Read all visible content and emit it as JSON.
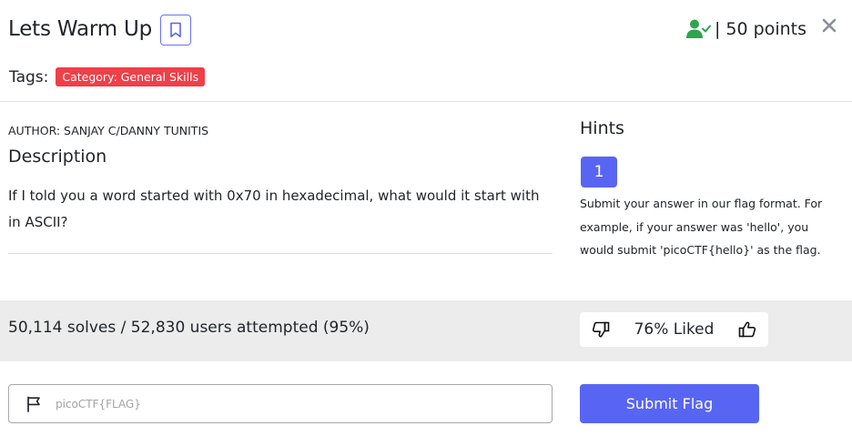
{
  "challenge": {
    "title": "Lets Warm Up",
    "points": "| 50 points",
    "tags_label": "Tags:",
    "tags": [
      "Category: General Skills"
    ],
    "author": "AUTHOR: SANJAY C/DANNY TUNITIS",
    "description_heading": "Description",
    "description": "If I told you a word started with 0x70 in hexadecimal, what would it start with in ASCII?"
  },
  "hints": {
    "heading": "Hints",
    "items": [
      {
        "label": "1",
        "text": "Submit your answer in our flag format. For example, if your answer was 'hello', you would submit 'picoCTF{hello}' as the flag."
      }
    ]
  },
  "stats": {
    "solves": "50,114 solves / 52,830 users attempted (95%)",
    "liked": "76% Liked"
  },
  "flag": {
    "placeholder": "picoCTF{FLAG}",
    "value": "",
    "submit_label": "Submit Flag"
  },
  "icons": {
    "bookmark": "bookmark-icon",
    "solved": "user-check-icon",
    "close": "close-icon",
    "thumbs_down": "thumbs-down-icon",
    "thumbs_up": "thumbs-up-icon",
    "flag": "flag-icon"
  },
  "colors": {
    "accent": "#5865f2",
    "tag": "#ef3f48",
    "solved": "#2ea44f",
    "band": "#ececec"
  }
}
